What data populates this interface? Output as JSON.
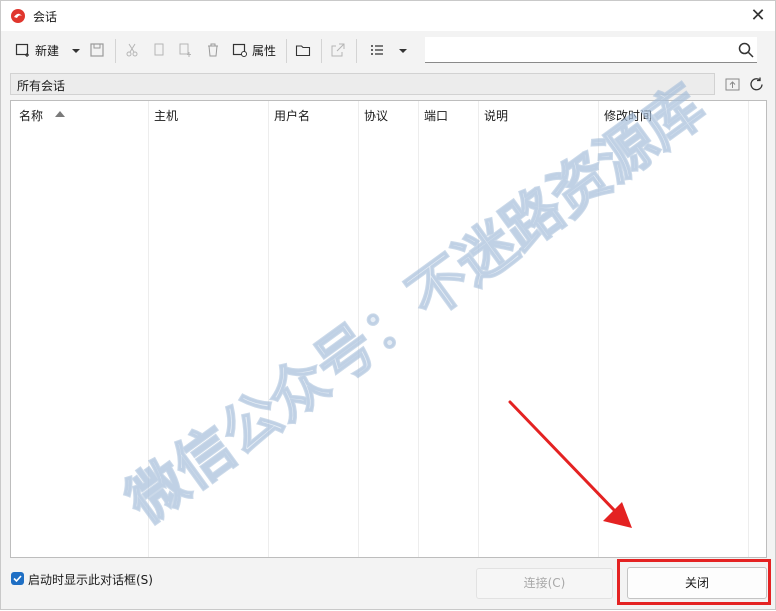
{
  "window": {
    "title": "会话"
  },
  "toolbar": {
    "new_label": "新建",
    "properties_label": "属性",
    "search_value": ""
  },
  "path": {
    "label": "所有会话"
  },
  "list": {
    "columns": [
      "名称",
      "主机",
      "用户名",
      "协议",
      "端口",
      "说明",
      "修改时间"
    ],
    "rows": []
  },
  "watermark": "微信公众号：不迷路资源库",
  "footer": {
    "startup_checkbox_label": "启动时显示此对话框(S)",
    "startup_checked": true,
    "connect_label": "连接(C)",
    "close_label": "关闭"
  },
  "colors": {
    "accent": "#1f6fc4",
    "annotation_red": "#e42222"
  }
}
